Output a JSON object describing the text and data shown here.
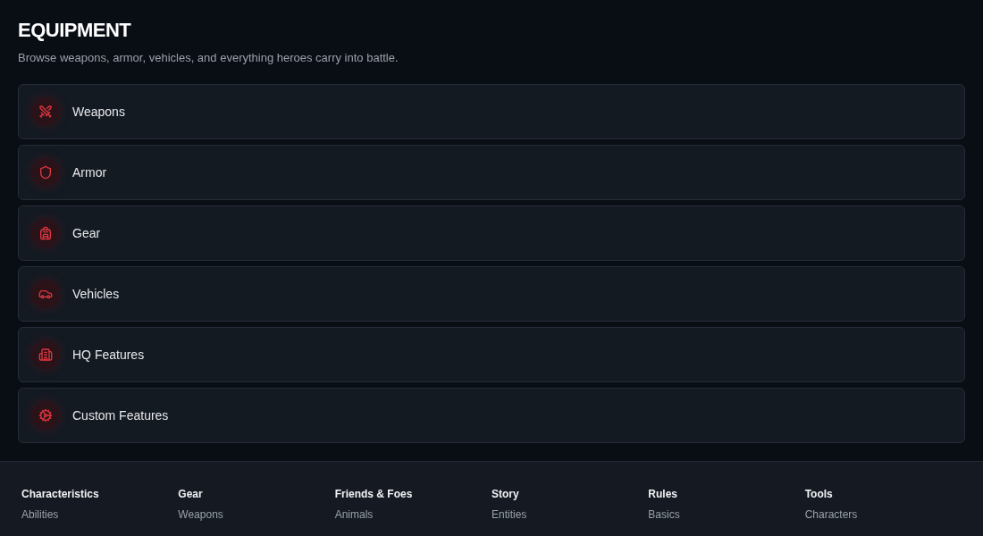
{
  "header": {
    "title": "EQUIPMENT",
    "subtitle": "Browse weapons, armor, vehicles, and everything heroes carry into battle."
  },
  "categories": [
    {
      "label": "Weapons",
      "kind": "swords"
    },
    {
      "label": "Armor",
      "kind": "shield"
    },
    {
      "label": "Gear",
      "kind": "backpack"
    },
    {
      "label": "Vehicles",
      "kind": "car"
    },
    {
      "label": "HQ Features",
      "kind": "building"
    },
    {
      "label": "Custom Features",
      "kind": "cog"
    }
  ],
  "footer": {
    "columns": [
      {
        "heading": "Characteristics",
        "links": [
          "Abilities"
        ]
      },
      {
        "heading": "Gear",
        "links": [
          "Weapons"
        ]
      },
      {
        "heading": "Friends & Foes",
        "links": [
          "Animals"
        ]
      },
      {
        "heading": "Story",
        "links": [
          "Entities"
        ]
      },
      {
        "heading": "Rules",
        "links": [
          "Basics"
        ]
      },
      {
        "heading": "Tools",
        "links": [
          "Characters"
        ]
      }
    ]
  }
}
